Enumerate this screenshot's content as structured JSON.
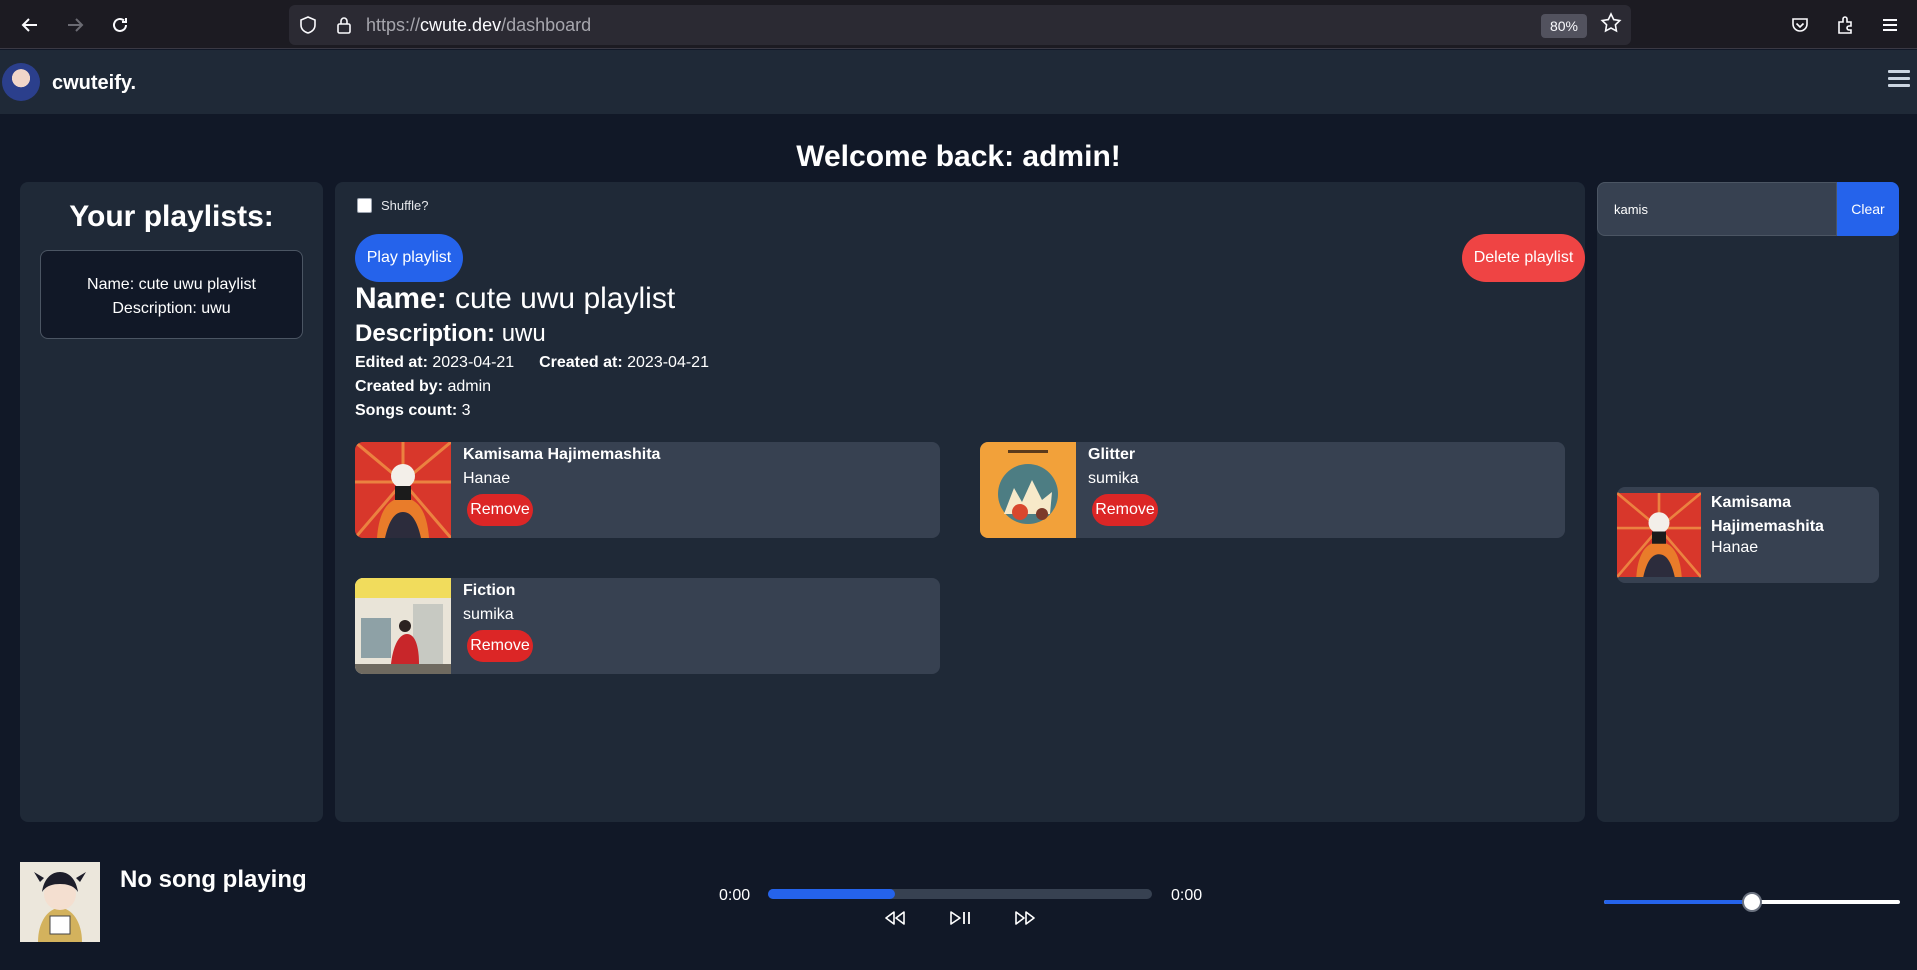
{
  "browser": {
    "url_scheme": "https://",
    "url_host": "cwute.dev",
    "url_path": "/dashboard",
    "zoom": "80%"
  },
  "header": {
    "brand": "cwuteify."
  },
  "welcome": "Welcome back: admin!",
  "playlists_panel": {
    "title": "Your playlists:",
    "items": [
      {
        "name_line": "Name: cute uwu playlist",
        "desc_line": "Description: uwu"
      }
    ]
  },
  "playlist": {
    "shuffle_label": "Shuffle?",
    "shuffle_checked": false,
    "play_label": "Play playlist",
    "delete_label": "Delete playlist",
    "name_label": "Name:",
    "name": "cute uwu playlist",
    "desc_label": "Description:",
    "description": "uwu",
    "edited_label": "Edited at:",
    "edited_at": "2023-04-21",
    "created_label": "Created at:",
    "created_at": "2023-04-21",
    "created_by_label": "Created by:",
    "created_by": "admin",
    "songs_count_label": "Songs count:",
    "songs_count": "3",
    "songs": [
      {
        "title": "Kamisama Hajimemashita",
        "artist": "Hanae",
        "remove_label": "Remove"
      },
      {
        "title": "Glitter",
        "artist": "sumika",
        "remove_label": "Remove"
      },
      {
        "title": "Fiction",
        "artist": "sumika",
        "remove_label": "Remove"
      }
    ]
  },
  "search": {
    "value": "kamis",
    "clear_label": "Clear",
    "results": [
      {
        "title": "Kamisama Hajimemashita",
        "artist": "Hanae"
      }
    ]
  },
  "player": {
    "now_playing": "No song playing",
    "time_current": "0:00",
    "time_total": "0:00",
    "progress": 0.33,
    "volume": 0.5
  },
  "colors": {
    "accent": "#2563eb",
    "danger": "#ef4444",
    "panel": "#1f2937",
    "background": "#111827"
  }
}
